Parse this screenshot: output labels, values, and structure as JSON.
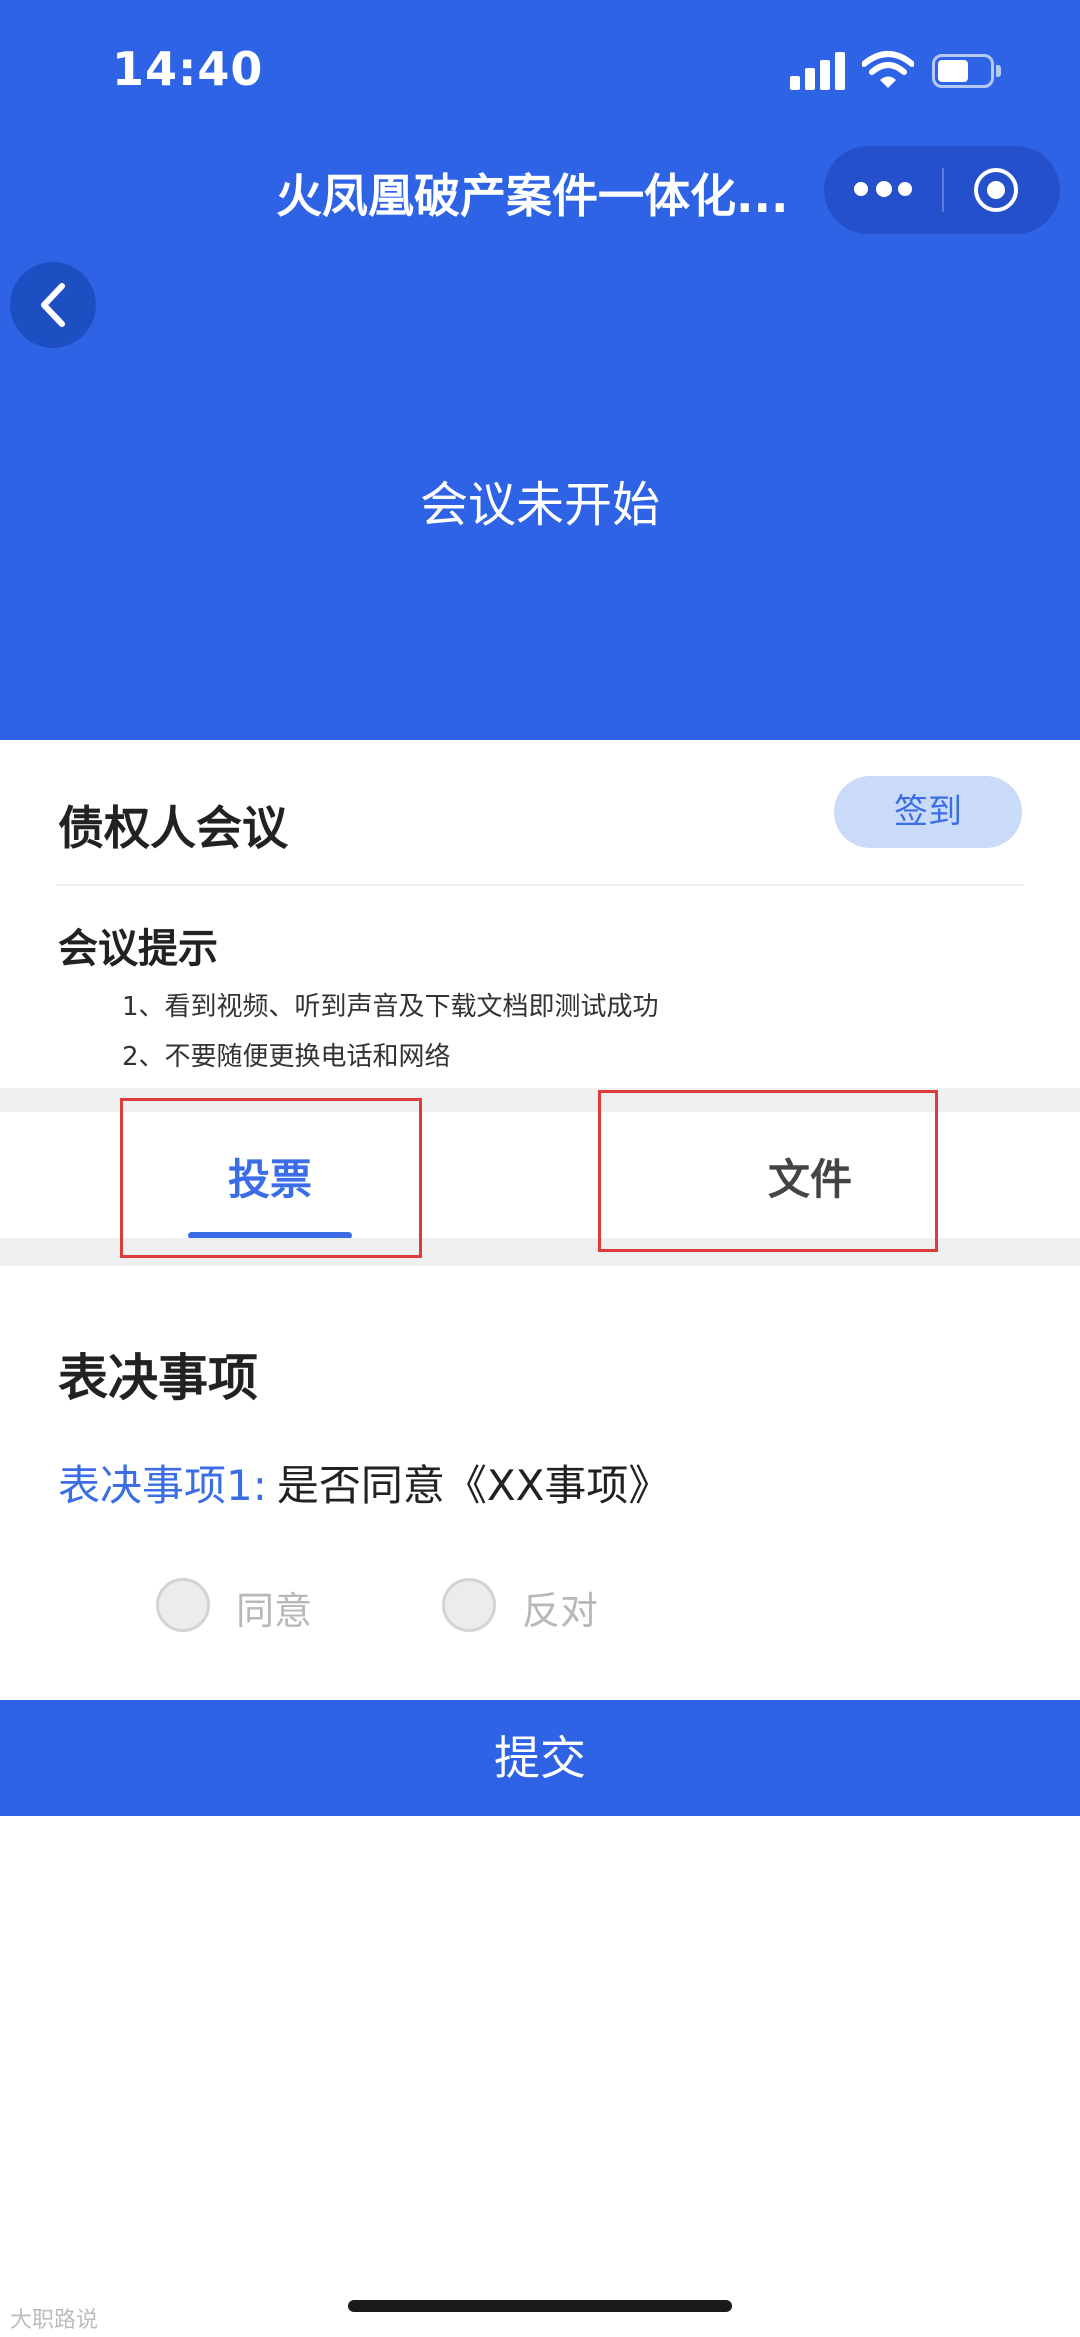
{
  "status_bar": {
    "time": "14:40",
    "icons": [
      "signal-icon",
      "wifi-icon",
      "battery-icon"
    ]
  },
  "nav": {
    "title": "火凤凰破产案件一体化...",
    "capsule_icons": [
      "more-icon",
      "target-icon"
    ],
    "back_icon": "chevron-left-icon"
  },
  "hero": {
    "meeting_status": "会议未开始"
  },
  "meeting": {
    "name": "债权人会议",
    "signin_label": "签到",
    "tips_title": "会议提示",
    "tips": [
      "1、看到视频、听到声音及下载文档即测试成功",
      "2、不要随便更换电话和网络"
    ]
  },
  "tabs": [
    {
      "label": "投票",
      "active": true
    },
    {
      "label": "文件",
      "active": false
    }
  ],
  "voting": {
    "section_title": "表决事项",
    "items": [
      {
        "label": "表决事项1:",
        "text": "是否同意《XX事项》",
        "options": [
          "同意",
          "反对"
        ]
      }
    ],
    "submit_label": "提交"
  },
  "watermark": "大职路说",
  "colors": {
    "primary": "#2f63e6",
    "accent_text": "#3b6ee6",
    "signin_bg": "#c9dbf8",
    "annotation_red": "#e03a3a"
  }
}
